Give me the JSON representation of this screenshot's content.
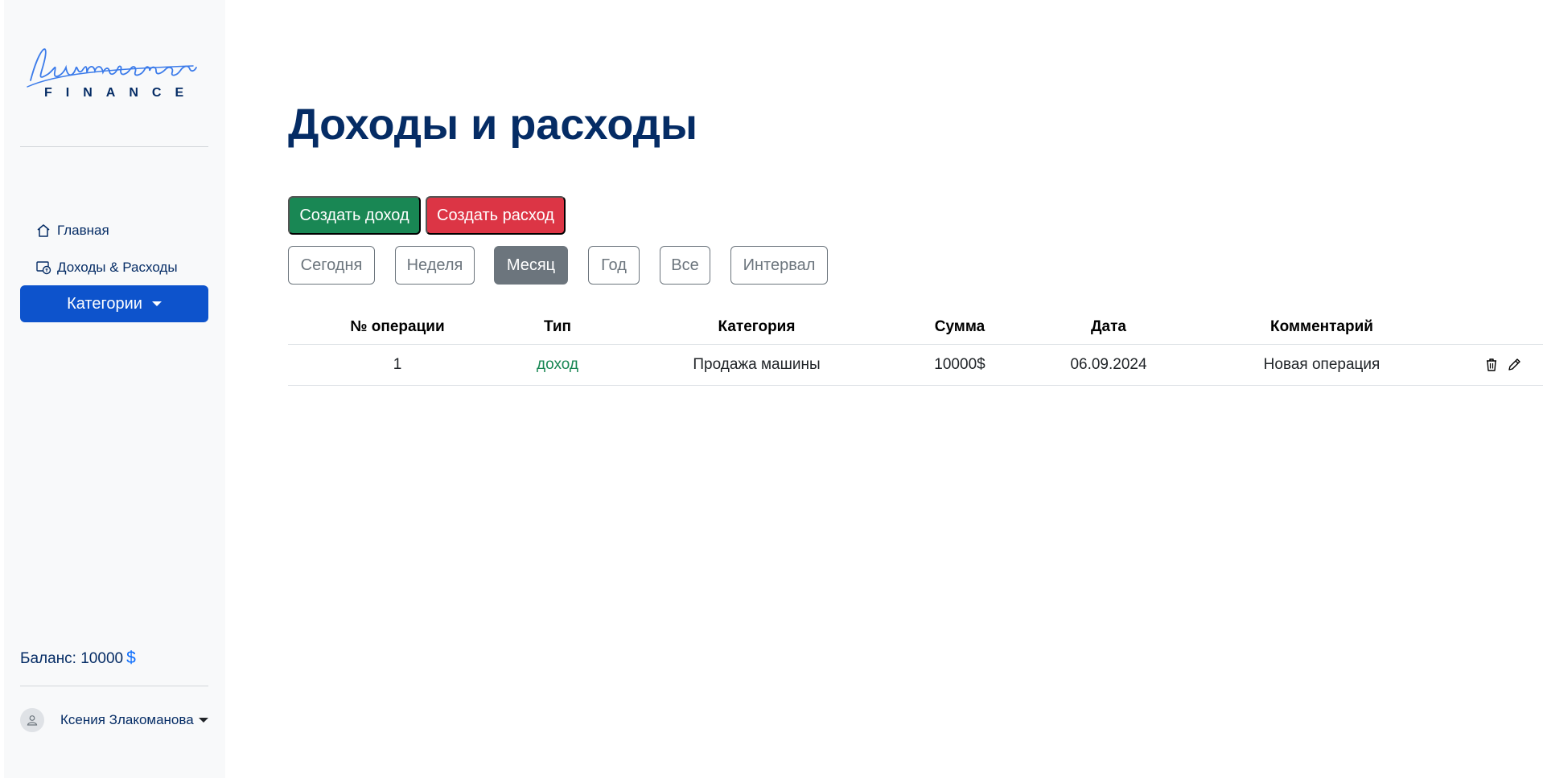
{
  "brand": {
    "logo_script": "Lumincoin",
    "logo_sub": "FINANCE",
    "logo_color": "#3b7bea",
    "logo_sub_color": "#052c65"
  },
  "sidebar": {
    "items": [
      {
        "label": "Главная",
        "icon": "home-icon"
      },
      {
        "label": "Доходы & Расходы",
        "icon": "wallet-icon"
      }
    ],
    "categories_label": "Категории",
    "balance_label": "Баланс: 10000",
    "balance_currency": "$",
    "user_name": "Ксения Злакоманова"
  },
  "page": {
    "title": "Доходы и расходы"
  },
  "actions": {
    "create_income": "Создать доход",
    "create_expense": "Создать расход"
  },
  "filters": [
    {
      "label": "Сегодня",
      "active": false
    },
    {
      "label": "Неделя",
      "active": false
    },
    {
      "label": "Месяц",
      "active": true
    },
    {
      "label": "Год",
      "active": false
    },
    {
      "label": "Все",
      "active": false
    },
    {
      "label": "Интервал",
      "active": false
    }
  ],
  "table": {
    "columns": [
      "№ операции",
      "Тип",
      "Категория",
      "Сумма",
      "Дата",
      "Комментарий"
    ],
    "rows": [
      {
        "number": "1",
        "type": "доход",
        "category": "Продажа машины",
        "amount": "10000$",
        "date": "06.09.2024",
        "comment": "Новая операция"
      }
    ]
  },
  "colors": {
    "primary": "#0d53cc",
    "success": "#198754",
    "danger": "#dc3545",
    "secondary": "#6c757d",
    "heading": "#052c65"
  }
}
